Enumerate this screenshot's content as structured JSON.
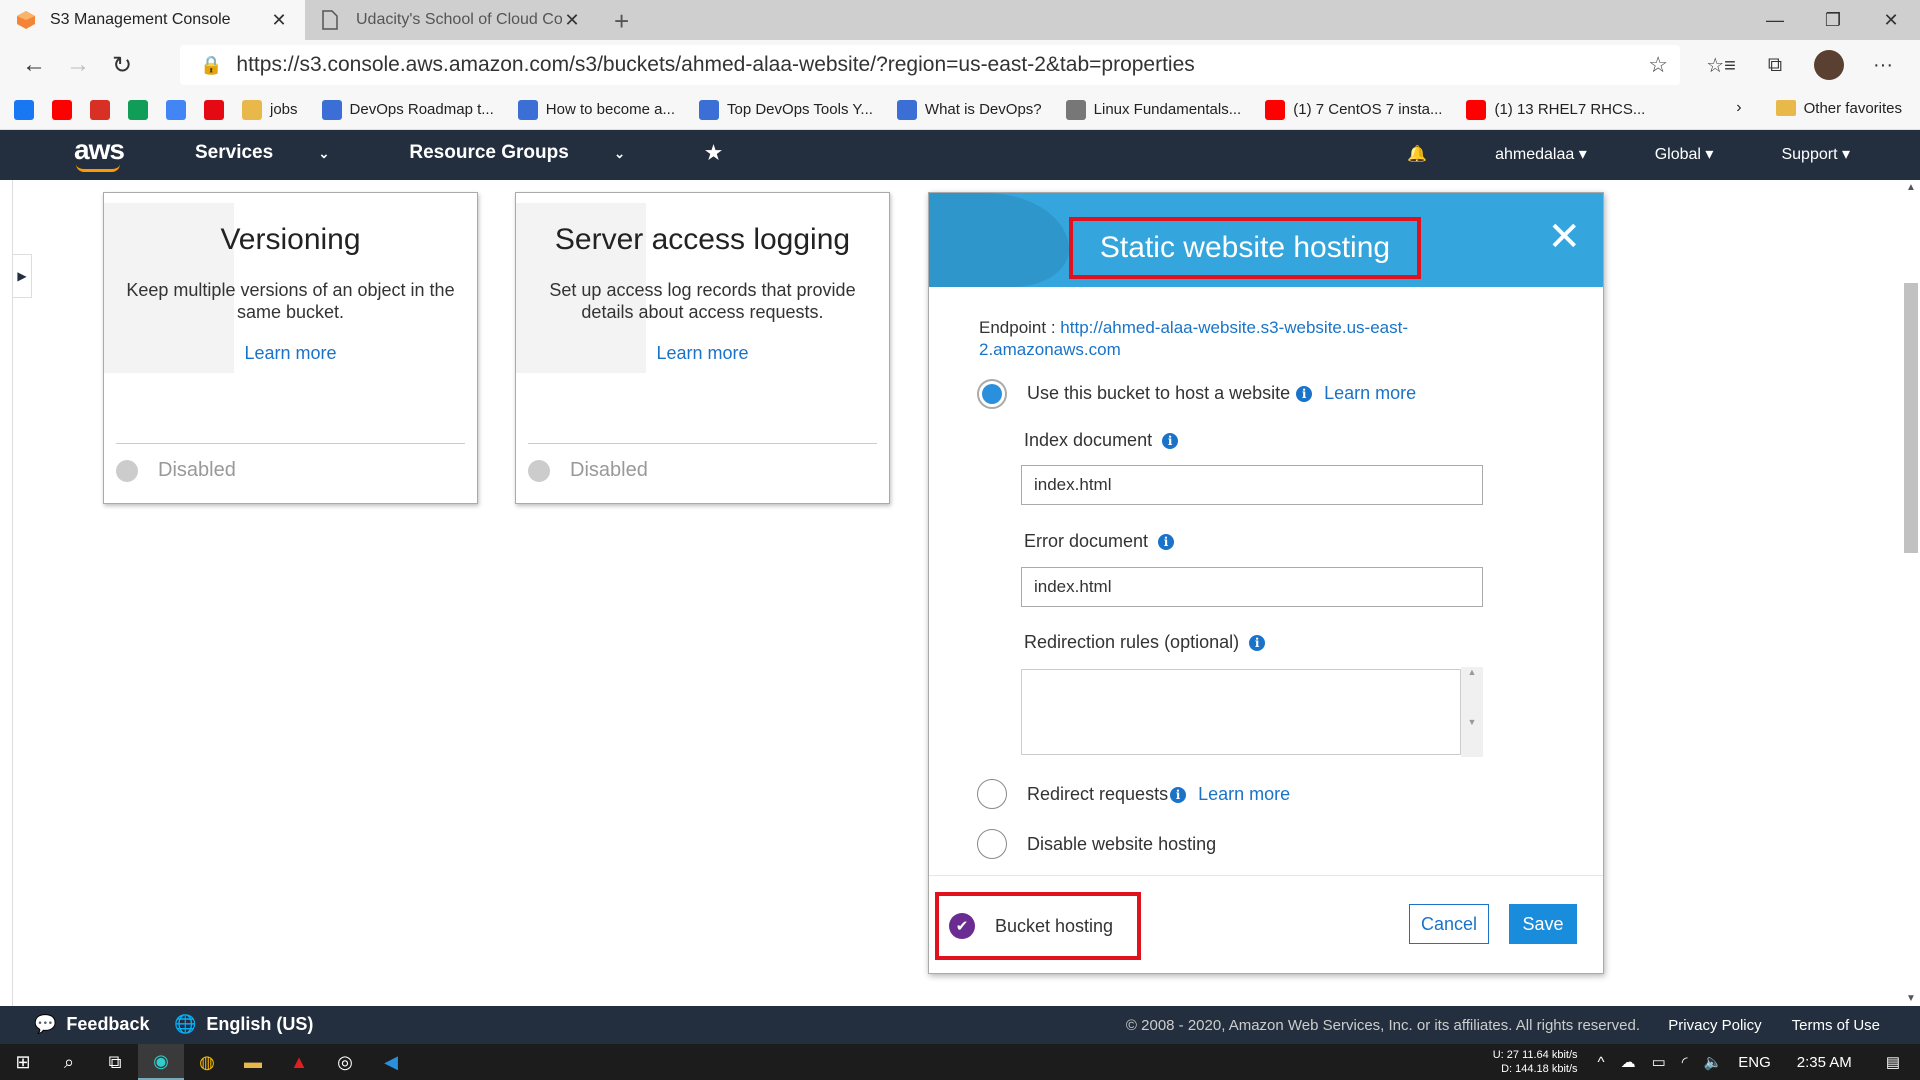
{
  "browser": {
    "tabs": [
      {
        "title": "S3 Management Console",
        "icon": "aws-s3-icon"
      },
      {
        "title": "Udacity's School of Cloud Comp",
        "icon": "page-icon"
      }
    ],
    "url": "https://s3.console.aws.amazon.com/s3/buckets/ahmed-alaa-website/?region=us-east-2&tab=properties",
    "bookmarks": [
      {
        "label": "",
        "icon": "facebook-icon",
        "color": "#1877f2"
      },
      {
        "label": "",
        "icon": "youtube-icon",
        "color": "#ff0000"
      },
      {
        "label": "",
        "icon": "gmail-icon",
        "color": "#d93025"
      },
      {
        "label": "",
        "icon": "drive-icon",
        "color": "#0f9d58"
      },
      {
        "label": "",
        "icon": "translate-icon",
        "color": "#4285f4"
      },
      {
        "label": "",
        "icon": "netflix-icon",
        "color": "#e50914"
      },
      {
        "label": "jobs",
        "icon": "folder-icon",
        "color": "#e8b84a"
      },
      {
        "label": "DevOps Roadmap t...",
        "icon": "link-icon",
        "color": "#3b6fd6"
      },
      {
        "label": "How to become a...",
        "icon": "link-icon",
        "color": "#3b6fd6"
      },
      {
        "label": "Top DevOps Tools Y...",
        "icon": "link-icon",
        "color": "#3b6fd6"
      },
      {
        "label": "What is DevOps?",
        "icon": "link-icon",
        "color": "#3b6fd6"
      },
      {
        "label": "Linux Fundamentals...",
        "icon": "page-icon",
        "color": "#777777"
      },
      {
        "label": "(1) 7 CentOS 7 insta...",
        "icon": "youtube-icon",
        "color": "#ff0000"
      },
      {
        "label": "(1) 13 RHEL7 RHCS...",
        "icon": "youtube-icon",
        "color": "#ff0000"
      }
    ],
    "other_favorites": "Other favorites"
  },
  "aws_nav": {
    "logo": "aws",
    "services": "Services",
    "resource_groups": "Resource Groups",
    "user": "ahmedalaa",
    "region": "Global",
    "support": "Support"
  },
  "cards": [
    {
      "title": "Versioning",
      "description": "Keep multiple versions of an object in the same bucket.",
      "link": "Learn more",
      "status": "Disabled"
    },
    {
      "title": "Server access logging",
      "description": "Set up access log records that provide details about access requests.",
      "link": "Learn more",
      "status": "Disabled"
    }
  ],
  "modal": {
    "title": "Static website hosting",
    "endpoint_label": "Endpoint :",
    "endpoint_url": "http://ahmed-alaa-website.s3-website.us-east-2.amazonaws.com",
    "option_host": "Use this bucket to host a website",
    "option_host_link": "Learn more",
    "index_label": "Index document",
    "index_value": "index.html",
    "error_label": "Error document",
    "error_value": "index.html",
    "redirection_label": "Redirection rules (optional)",
    "redirection_value": "",
    "option_redirect": "Redirect requests",
    "option_redirect_link": "Learn more",
    "option_disable": "Disable website hosting",
    "selected_option": "Use this bucket to host a website",
    "bucket_hosting": "Bucket hosting",
    "cancel": "Cancel",
    "save": "Save"
  },
  "footer": {
    "feedback": "Feedback",
    "language": "English (US)",
    "copyright": "© 2008 - 2020, Amazon Web Services, Inc. or its affiliates. All rights reserved.",
    "privacy": "Privacy Policy",
    "terms": "Terms of Use"
  },
  "taskbar": {
    "upload": "U:   27 11.64 kbit/s",
    "download": "D:     144.18 kbit/s",
    "lang": "ENG",
    "time": "2:35 AM"
  }
}
